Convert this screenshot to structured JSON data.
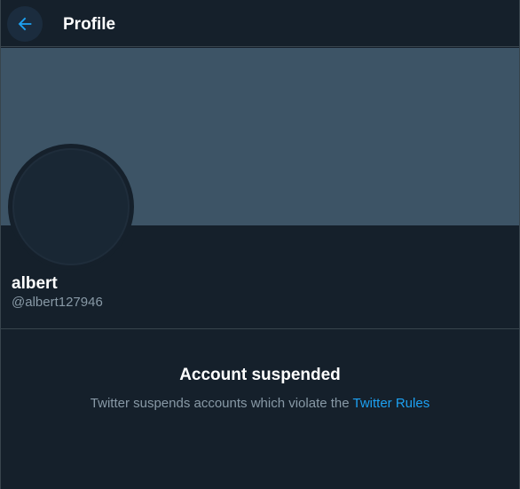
{
  "header": {
    "title": "Profile",
    "back_icon": "arrow-left-icon"
  },
  "profile": {
    "display_name": "albert",
    "handle": "@albert127946"
  },
  "notice": {
    "title": "Account suspended",
    "text": "Twitter suspends accounts which violate the ",
    "link_label": "Twitter Rules"
  },
  "colors": {
    "background": "#15202b",
    "banner": "#3d5466",
    "accent": "#1da1f2",
    "secondary_text": "#8899a6",
    "border": "#38444d"
  }
}
